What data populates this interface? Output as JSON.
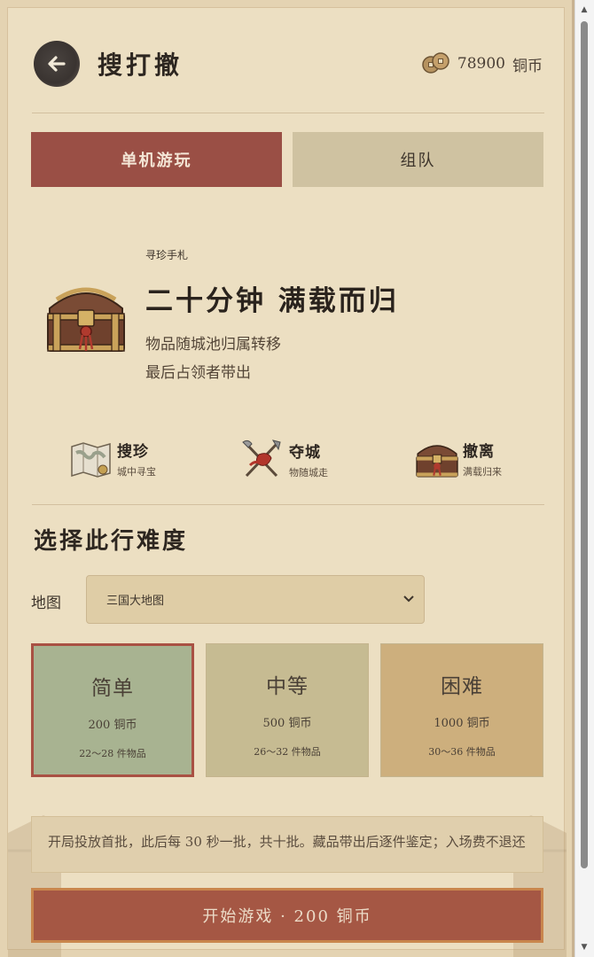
{
  "header": {
    "title": "搜打撤",
    "coin_amount": "78900",
    "coin_unit": "铜币",
    "back_icon": "arrow-left-icon",
    "coin_icon": "copper-coins-icon"
  },
  "tabs": [
    {
      "label": "单机游玩",
      "active": true
    },
    {
      "label": "组队",
      "active": false
    }
  ],
  "hero": {
    "subtitle": "寻珍手札",
    "title": "二十分钟 满载而归",
    "lines": [
      "物品随城池归属转移",
      "最后占领者带出"
    ]
  },
  "features": [
    {
      "name": "搜珍",
      "desc": "城中寻宝",
      "icon": "treasure-map-icon"
    },
    {
      "name": "夺城",
      "desc": "物随城走",
      "icon": "crossed-weapons-icon"
    },
    {
      "name": "撤离",
      "desc": "满载归来",
      "icon": "treasure-chest-icon"
    }
  ],
  "difficulty": {
    "section_title": "选择此行难度",
    "map_label": "地图",
    "map_value": "三国大地图",
    "options": [
      {
        "name": "简单",
        "cost": "200 铜币",
        "items": "22～28 件物品",
        "selected": true
      },
      {
        "name": "中等",
        "cost": "500 铜币",
        "items": "26～32 件物品",
        "selected": false
      },
      {
        "name": "困难",
        "cost": "1000 铜币",
        "items": "30～36 件物品",
        "selected": false
      }
    ]
  },
  "note": "开局投放首批，此后每 30 秒一批，共十批。藏品带出后逐件鉴定；入场费不退还",
  "start_button": "开始游戏 · 200 铜币",
  "colors": {
    "accent": "#9a4f45",
    "start_button": "#a55744",
    "easy": "#a8b391",
    "medium": "#c6bb92",
    "hard": "#cdaf7d"
  }
}
